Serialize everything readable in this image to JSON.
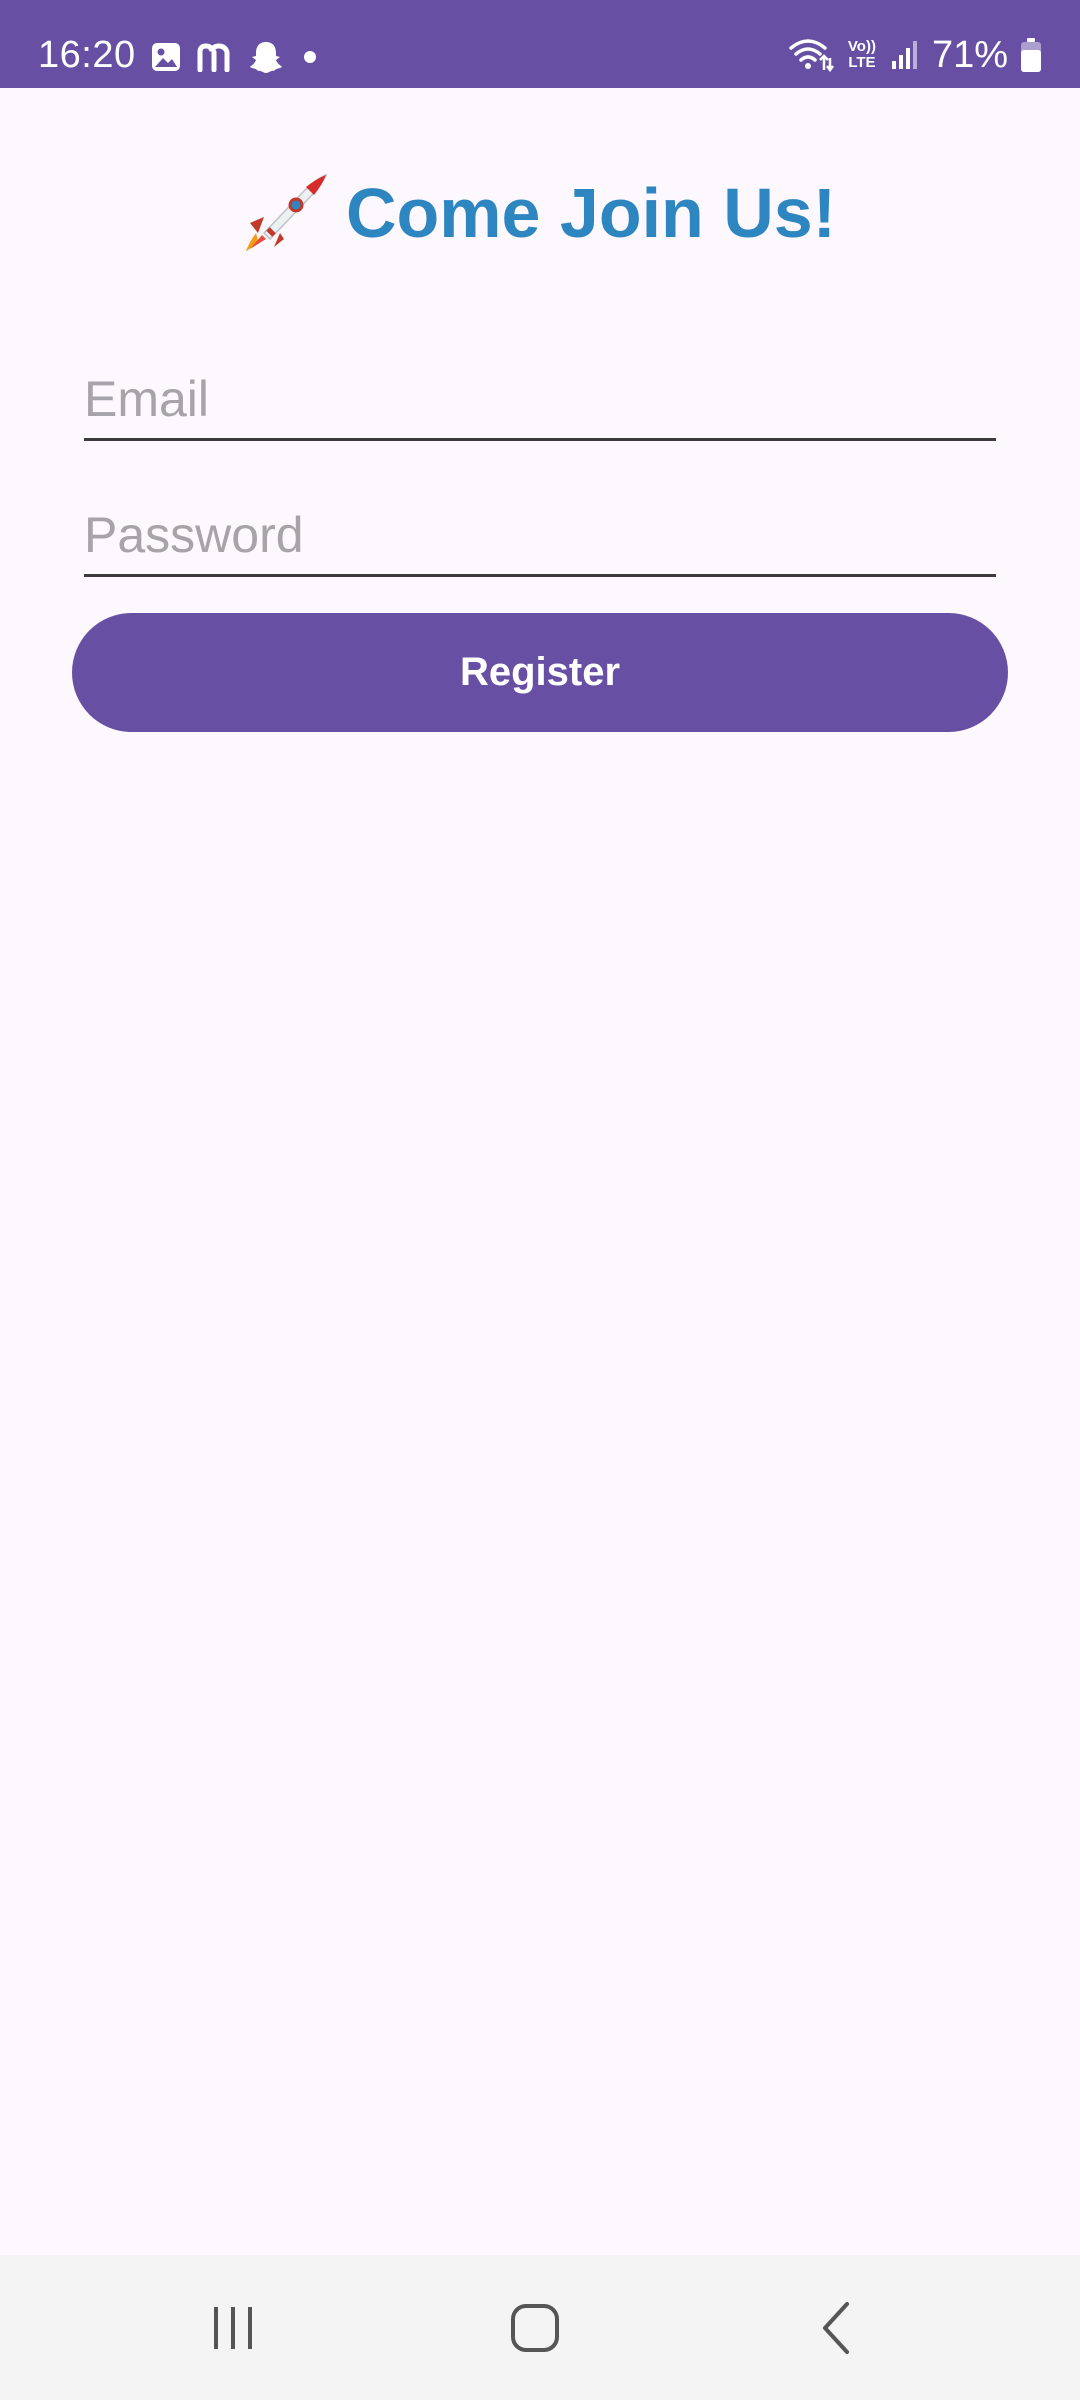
{
  "status_bar": {
    "time": "16:20",
    "battery_percent": "71%",
    "network_label_top": "Vo))",
    "network_label_bottom": "LTE",
    "left_icons": [
      "gallery-icon",
      "m-app-icon",
      "snapchat-icon",
      "notification-dot-icon"
    ],
    "right_icons": [
      "wifi-icon",
      "volte-icon",
      "signal-icon",
      "battery-icon"
    ]
  },
  "header": {
    "emoji": "🚀",
    "title": "Come Join Us!"
  },
  "form": {
    "email_placeholder": "Email",
    "password_placeholder": "Password",
    "register_label": "Register"
  },
  "nav_bar": {
    "buttons": [
      "recents",
      "home",
      "back"
    ]
  },
  "colors": {
    "primary": "#6750a4",
    "title": "#2e86c1",
    "background": "#fdf7fe"
  }
}
